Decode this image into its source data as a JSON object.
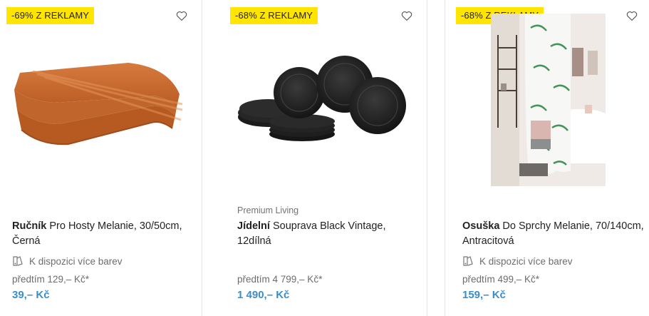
{
  "products": [
    {
      "badge": "-69% Z REKLAMY",
      "brand": "",
      "title_bold": "Ručník",
      "title_rest": " Pro Hosty Melanie, 30/50cm, Černá",
      "colors_text": "K dispozici více barev",
      "old_price": "předtím 129,– Kč*",
      "price": "39,– Kč",
      "image": "towel-image"
    },
    {
      "badge": "-68% Z REKLAMY",
      "brand": "Premium Living",
      "title_bold": "Jídelní",
      "title_rest": " Souprava Black Vintage, 12dílná",
      "colors_text": "",
      "old_price": "předtím 4 799,– Kč*",
      "price": "1 490,– Kč",
      "image": "dinnerware-set-image"
    },
    {
      "badge": "-68% Z REKLAMY",
      "brand": "",
      "title_bold": "Osuška",
      "title_rest": " Do Sprchy Melanie, 70/140cm, Antracitová",
      "colors_text": "K dispozici více barev",
      "old_price": "předtím 499,– Kč*",
      "price": "159,– Kč",
      "image": "shower-curtain-image"
    }
  ],
  "colors": {
    "badge_bg": "#ffe500",
    "price": "#3b8ec8",
    "muted": "#6d6d6d"
  },
  "icons": {
    "wishlist": "heart-outline-icon",
    "colors": "color-variants-icon"
  }
}
